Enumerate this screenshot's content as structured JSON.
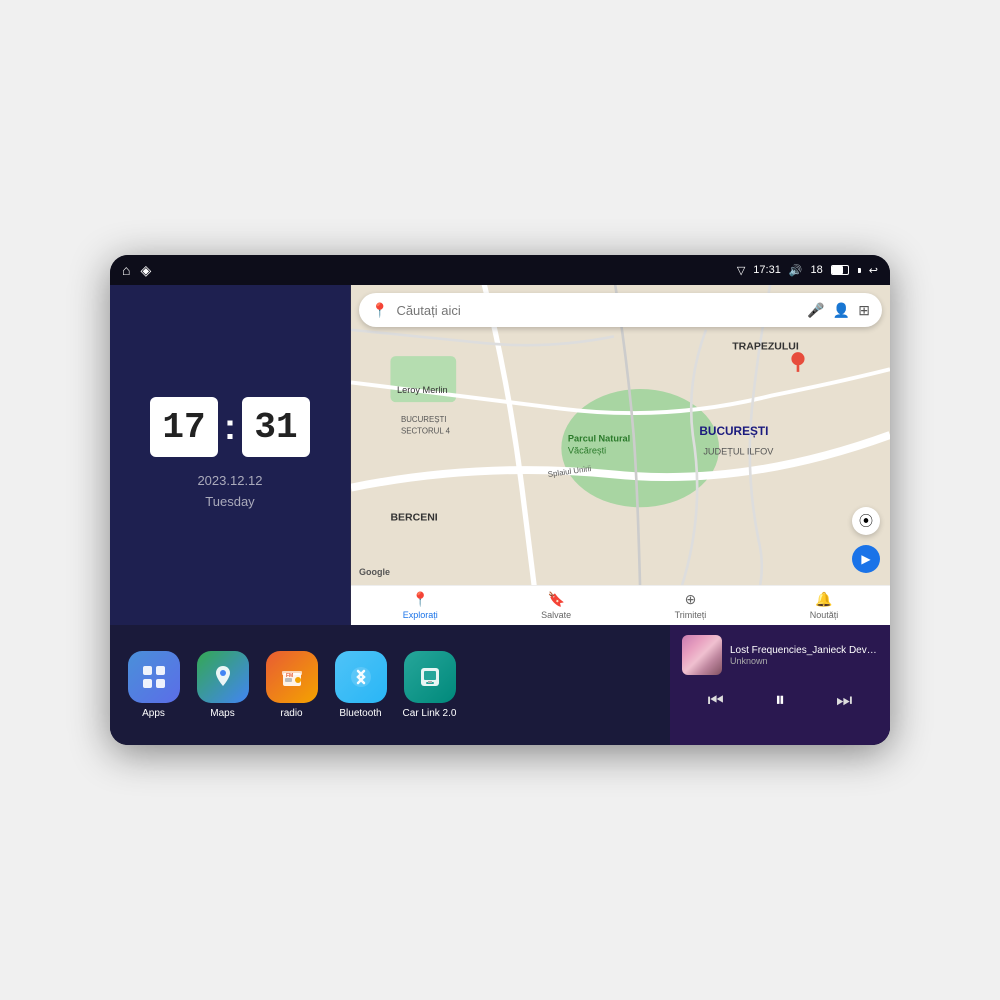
{
  "device": {
    "status_bar": {
      "time": "17:31",
      "signal_strength": "18",
      "home_icon": "⌂",
      "nav_icon": "◈",
      "back_icon": "↩"
    },
    "clock": {
      "hours": "17",
      "minutes": "31",
      "date": "2023.12.12",
      "day": "Tuesday"
    },
    "map": {
      "search_placeholder": "Căutați aici",
      "nav_items": [
        {
          "label": "Explorați",
          "icon": "📍",
          "active": true
        },
        {
          "label": "Salvate",
          "icon": "🔖",
          "active": false
        },
        {
          "label": "Trimiteți",
          "icon": "⊕",
          "active": false
        },
        {
          "label": "Noutăți",
          "icon": "🔔",
          "active": false
        }
      ],
      "labels": [
        "TRAPEZULUI",
        "BUCUREȘTI",
        "JUDEȚUL ILFOV",
        "BERCENI",
        "Parcul Natural Văcărești",
        "Leroy Merlin",
        "BUCUREȘTI SECTORUL 4",
        "Splaiul Unirii"
      ]
    },
    "apps": [
      {
        "id": "apps",
        "label": "Apps",
        "icon_class": "icon-apps",
        "icon": "⊞"
      },
      {
        "id": "maps",
        "label": "Maps",
        "icon_class": "icon-maps",
        "icon": "📍"
      },
      {
        "id": "radio",
        "label": "radio",
        "icon_class": "icon-radio",
        "icon": "📻"
      },
      {
        "id": "bluetooth",
        "label": "Bluetooth",
        "icon_class": "icon-bluetooth",
        "icon": "⚡"
      },
      {
        "id": "carlink",
        "label": "Car Link 2.0",
        "icon_class": "icon-carlink",
        "icon": "📱"
      }
    ],
    "music": {
      "title": "Lost Frequencies_Janieck Devy-...",
      "artist": "Unknown",
      "prev_icon": "⏮",
      "play_icon": "⏸",
      "next_icon": "⏭"
    }
  }
}
